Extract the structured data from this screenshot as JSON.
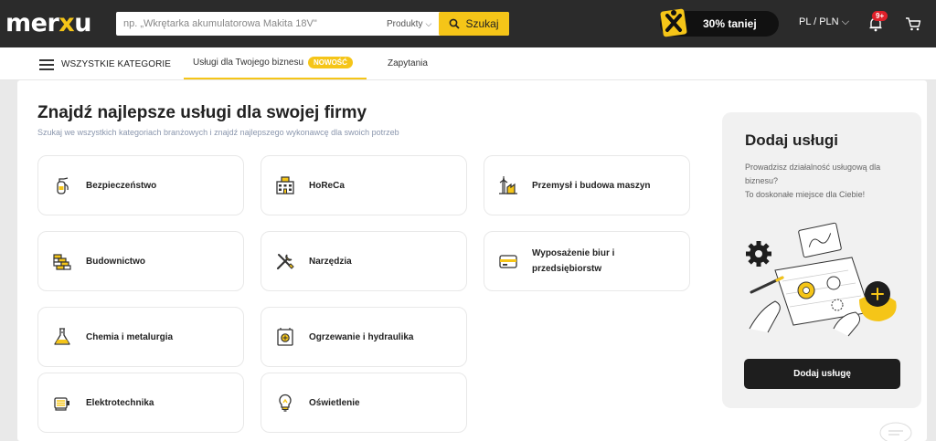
{
  "header": {
    "logo_left": "mer",
    "logo_x": "x",
    "logo_right": "u",
    "search_placeholder": "np. „Wkrętarka akumulatorowa Makita 18V\"",
    "search_category": "Produkty",
    "search_button": "Szukaj",
    "promo_text": "30% taniej",
    "language": "PL / PLN",
    "notifications_badge": "9+"
  },
  "nav": {
    "all_categories": "WSZYSTKIE KATEGORIE",
    "tabs": [
      {
        "label": "Usługi dla Twojego biznesu",
        "badge": "NOWOŚĆ",
        "active": true
      },
      {
        "label": "Zapytania"
      }
    ]
  },
  "main": {
    "title": "Znajdź najlepsze usługi dla swojej firmy",
    "subtitle": "Szukaj we wszystkich kategoriach branżowych i znajdź najlepszego wykonawcę dla swoich potrzeb",
    "categories": [
      {
        "label": "Bezpieczeństwo",
        "icon": "fire-extinguisher-icon"
      },
      {
        "label": "HoReCa",
        "icon": "hotel-icon"
      },
      {
        "label": "Przemysł i budowa maszyn",
        "icon": "factory-icon"
      },
      {
        "label": "Budownictwo",
        "icon": "bricks-icon"
      },
      {
        "label": "Narzędzia",
        "icon": "tools-icon"
      },
      {
        "label": "Wyposażenie biur i przedsiębiorstw",
        "icon": "office-equipment-icon"
      },
      {
        "label": "Chemia i metalurgia",
        "icon": "flask-icon"
      },
      {
        "label": "Ogrzewanie i hydraulika",
        "icon": "boiler-icon"
      },
      {
        "label": "Elektrotechnika",
        "icon": "electric-motor-icon"
      },
      {
        "label": "Oświetlenie",
        "icon": "lightbulb-icon"
      }
    ]
  },
  "sidebar": {
    "title": "Dodaj usługi",
    "text_line1": "Prowadzisz działalność usługową dla biznesu?",
    "text_line2": "To doskonałe miejsce dla Ciebie!",
    "button": "Dodaj usługę"
  },
  "colors": {
    "accent": "#f5c518",
    "topbar": "#2b2b2b",
    "dark_button": "#1e1e1e"
  }
}
